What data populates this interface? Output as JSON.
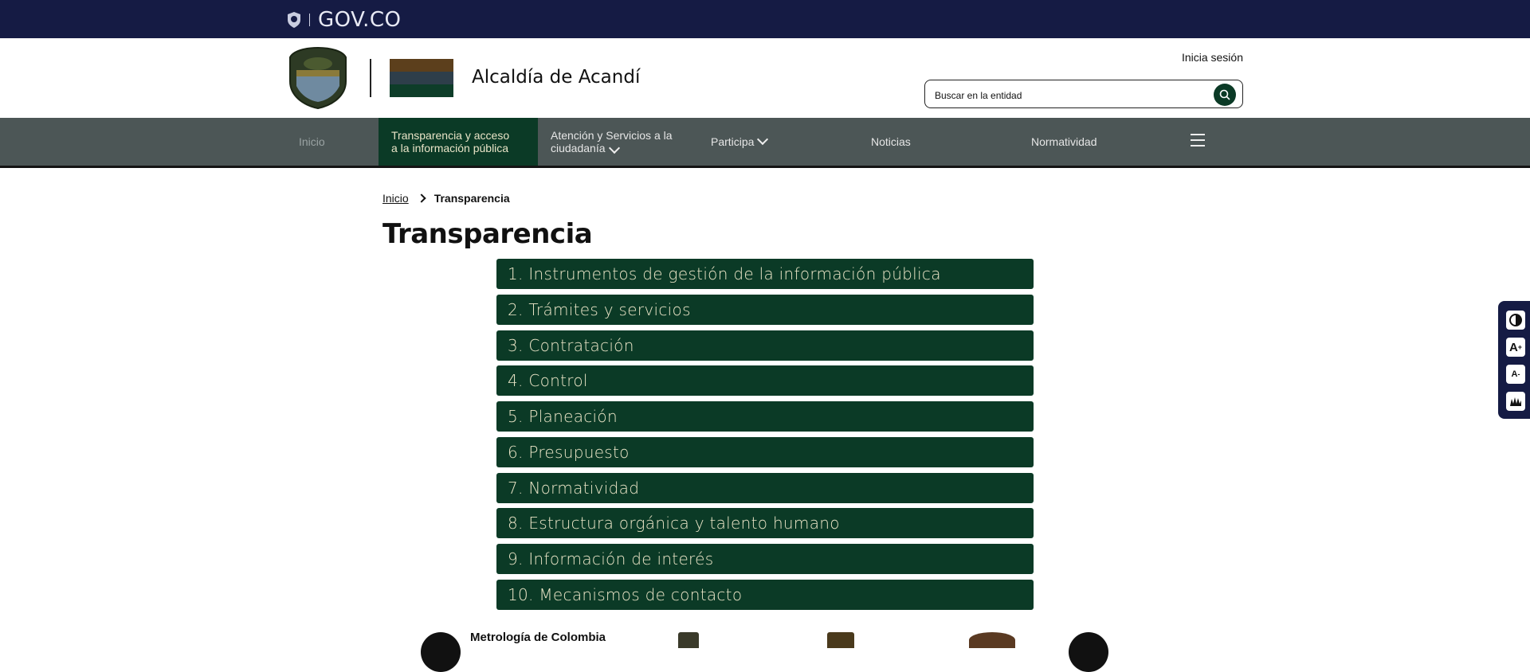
{
  "govbar": {
    "logo_text": "GOV.CO"
  },
  "header": {
    "entity_name": "Alcaldía de Acandí",
    "login_label": "Inicia sesión",
    "search_placeholder": "Buscar en la entidad",
    "flag_colors": [
      "#5c3f1c",
      "#2e3e4a",
      "#0e3d29"
    ]
  },
  "nav": {
    "items": [
      {
        "label": "Inicio"
      },
      {
        "label_line1": "Transparencia y acceso",
        "label_line2": "a la información pública"
      },
      {
        "label_line1": "Atención y Servicios a la",
        "label_line2": "ciudadanía"
      },
      {
        "label": "Participa"
      },
      {
        "label": "Noticias"
      },
      {
        "label": "Normatividad"
      }
    ]
  },
  "breadcrumb": {
    "home": "Inicio",
    "current": "Transparencia"
  },
  "page": {
    "title": "Transparencia",
    "menu": [
      "1. Instrumentos de gestión de la información pública",
      "2. Trámites y servicios",
      "3. Contratación",
      "4. Control",
      "5. Planeación",
      "6. Presupuesto",
      "7. Normatividad",
      "8. Estructura orgánica y talento humano",
      "9. Información de interés",
      "10. Mecanismos de contacto"
    ]
  },
  "carousel": {
    "item_title": "Metrología de Colombia"
  },
  "colors": {
    "govbar": "#151b44",
    "primary_green": "#0b3a26",
    "nav_bg": "#4c5656"
  }
}
